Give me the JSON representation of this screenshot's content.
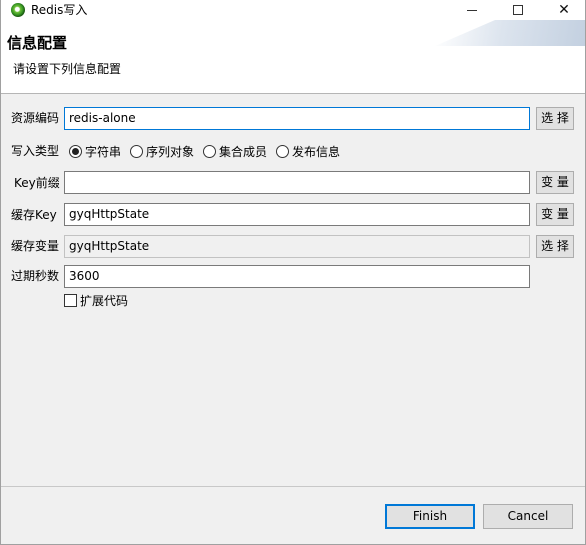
{
  "window": {
    "title": "Redis写入"
  },
  "header": {
    "title": "信息配置",
    "description": "请设置下列信息配置"
  },
  "form": {
    "resource_code": {
      "label": "资源编码",
      "value": "redis-alone",
      "button": "选 择"
    },
    "write_type": {
      "label": "写入类型",
      "options": [
        "字符串",
        "序列对象",
        "集合成员",
        "发布信息"
      ],
      "selected": "字符串"
    },
    "key_prefix": {
      "label": "Key前缀",
      "value": "",
      "button": "变 量"
    },
    "cache_key": {
      "label": "缓存Key",
      "value": "gyqHttpState",
      "button": "变 量"
    },
    "cache_var": {
      "label": "缓存变量",
      "value": "gyqHttpState",
      "button": "选 择"
    },
    "expire_seconds": {
      "label": "过期秒数",
      "value": "3600"
    },
    "extend_code": {
      "label": "扩展代码",
      "checked": false
    }
  },
  "footer": {
    "finish_label": "Finish",
    "cancel_label": "Cancel"
  }
}
